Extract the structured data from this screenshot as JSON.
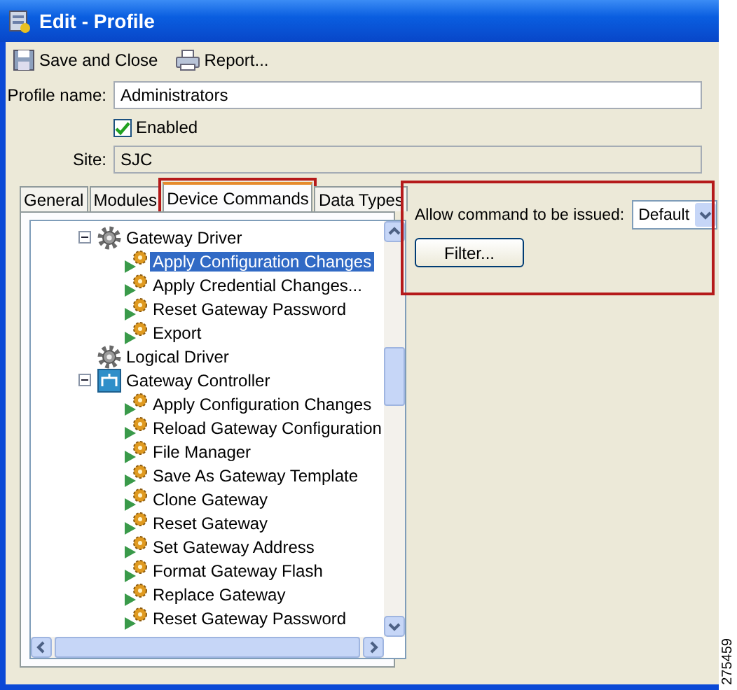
{
  "window": {
    "title": "Edit - Profile"
  },
  "toolbar": [
    {
      "label": "Save and Close",
      "kind": "save"
    },
    {
      "label": "Report...",
      "kind": "report"
    }
  ],
  "form": {
    "profile_name": {
      "label": "Profile name:",
      "value": "Administrators"
    },
    "enabled": {
      "label": "Enabled",
      "checked": true
    },
    "site": {
      "label": "Site:",
      "value": "SJC"
    }
  },
  "tabs": [
    {
      "label": "General",
      "selected": false,
      "highlighted": false
    },
    {
      "label": "Modules",
      "selected": false,
      "highlighted": false
    },
    {
      "label": "Device Commands",
      "selected": true,
      "highlighted": true
    },
    {
      "label": "Data Types",
      "selected": false,
      "highlighted": false
    }
  ],
  "tree": [
    {
      "label": "Gateway Driver",
      "kind": "driver",
      "expanded": true,
      "selected": false,
      "children": [
        {
          "label": "Apply Configuration Changes",
          "kind": "command",
          "selected": true
        },
        {
          "label": "Apply Credential Changes...",
          "kind": "command",
          "selected": false
        },
        {
          "label": "Reset Gateway Password",
          "kind": "command",
          "selected": false
        },
        {
          "label": "Export",
          "kind": "command",
          "selected": false
        }
      ]
    },
    {
      "label": "Logical Driver",
      "kind": "driver",
      "selected": false
    },
    {
      "label": "Gateway Controller",
      "kind": "controller",
      "expanded": true,
      "selected": false,
      "children": [
        {
          "label": "Apply Configuration Changes",
          "kind": "command",
          "selected": false
        },
        {
          "label": "Reload Gateway Configuration",
          "kind": "command",
          "selected": false
        },
        {
          "label": "File Manager",
          "kind": "command",
          "selected": false
        },
        {
          "label": "Save As Gateway Template",
          "kind": "command",
          "selected": false
        },
        {
          "label": "Clone Gateway",
          "kind": "command",
          "selected": false
        },
        {
          "label": "Reset Gateway",
          "kind": "command",
          "selected": false
        },
        {
          "label": "Set Gateway Address",
          "kind": "command",
          "selected": false
        },
        {
          "label": "Format Gateway Flash",
          "kind": "command",
          "selected": false
        },
        {
          "label": "Replace Gateway",
          "kind": "command",
          "selected": false
        },
        {
          "label": "Reset Gateway Password",
          "kind": "command",
          "selected": false
        }
      ]
    }
  ],
  "command_panel": {
    "highlighted": true,
    "allow_label": "Allow command to be issued:",
    "allow_value": "Default",
    "filter_button": "Filter..."
  },
  "figure_number": "275459"
}
